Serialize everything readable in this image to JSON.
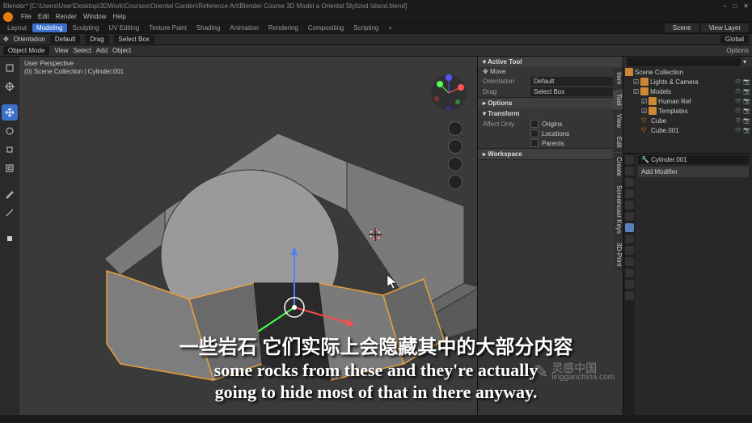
{
  "titlebar": {
    "text": "Blender* [C:\\Users\\User\\Desktop\\3DWork\\Courses\\Oriental Garden\\Reference Art\\Blender Course 3D Model a Oriental Stylized Island.blend]"
  },
  "menubar": {
    "items": [
      "File",
      "Edit",
      "Render",
      "Window",
      "Help"
    ]
  },
  "workspaces": {
    "tabs": [
      "Layout",
      "Modeling",
      "Sculpting",
      "UV Editing",
      "Texture Paint",
      "Shading",
      "Animation",
      "Rendering",
      "Compositing",
      "Scripting"
    ],
    "active": 1,
    "scene": "Scene",
    "view_layer": "View Layer"
  },
  "toolbar": {
    "orientation_label": "Orientation",
    "orientation": "Default",
    "drag": "Drag",
    "select": "Select Box",
    "global": "Global"
  },
  "header": {
    "mode": "Object Mode",
    "menus": [
      "View",
      "Select",
      "Add",
      "Object"
    ],
    "options": "Options"
  },
  "viewport": {
    "info_line1": "User Perspective",
    "info_line2": "(0) Scene Collection | Cylinder.001"
  },
  "npanel": {
    "active_tool": "Active Tool",
    "move": "Move",
    "orientation_label": "Orientation",
    "orientation_val": "Default",
    "drag_label": "Drag",
    "drag_val": "Select Box",
    "options": "Options",
    "transform": "Transform",
    "affect_only": "Affect Only",
    "origins": "Origins",
    "locations": "Locations",
    "parents": "Parents",
    "workspace": "Workspace"
  },
  "nside_tabs": [
    "Item",
    "Tool",
    "View",
    "Edit",
    "Create",
    "Screencast Keys",
    "3D-Print"
  ],
  "outliner": {
    "search_placeholder": "",
    "root": "Scene Collection",
    "items": [
      {
        "name": "Lights & Camera",
        "type": "coll",
        "indent": 1
      },
      {
        "name": "Models",
        "type": "coll",
        "indent": 1
      },
      {
        "name": "Human Ref",
        "type": "coll",
        "indent": 2
      },
      {
        "name": "Templates",
        "type": "coll",
        "indent": 2
      },
      {
        "name": "Cube",
        "type": "obj",
        "indent": 2
      },
      {
        "name": "Cube.001",
        "type": "obj",
        "indent": 2
      }
    ]
  },
  "props": {
    "breadcrumb": "Cylinder.001",
    "add_modifier": "Add Modifier"
  },
  "subtitle": {
    "zh": "一些岩石 它们实际上会隐藏其中的大部分内容",
    "en1": "some rocks from these and they're actually",
    "en2": "going to hide most of that in there anyway."
  },
  "watermark": {
    "cn": "灵感中国",
    "url": "lingganchina.com"
  }
}
